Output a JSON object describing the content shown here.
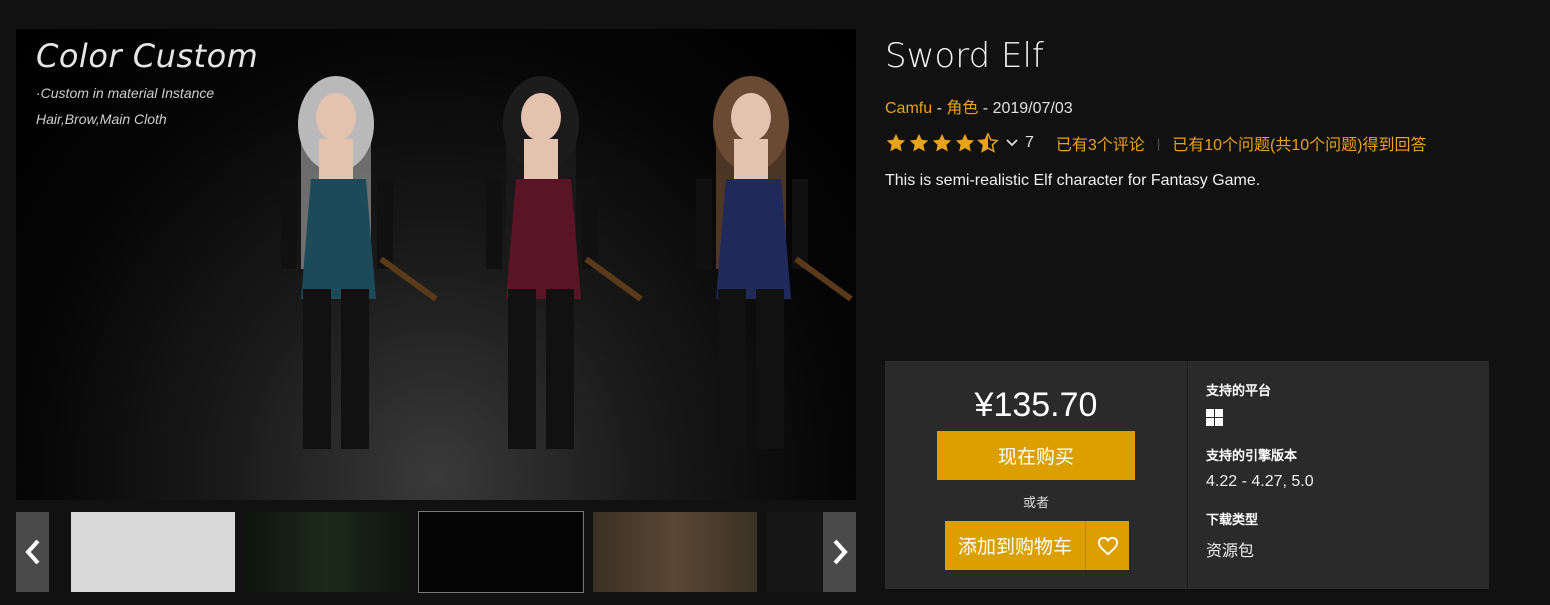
{
  "hero": {
    "overlay_title": "Color Custom",
    "overlay_line1": "·Custom in material Instance",
    "overlay_line2": "Hair,Brow,Main Cloth"
  },
  "gallery": {
    "prev_icon": "chevron-left-icon",
    "next_icon": "chevron-right-icon",
    "thumbnail_count": 5
  },
  "product": {
    "title": "Sword Elf",
    "seller": "Camfu",
    "meta_sep1": " - ",
    "category": "角色",
    "meta_sep2": " - ",
    "date": "2019/07/03",
    "rating_value": 4.5,
    "rating_count": "7",
    "reviews_link": "已有3个评论",
    "questions_link": "已有10个问题(共10个问题)得到回答",
    "description": "This is semi-realistic Elf character for Fantasy Game."
  },
  "purchase": {
    "price": "¥135.70",
    "buy_now": "现在购买",
    "or": "或者",
    "add_to_cart": "添加到购物车",
    "wishlist_icon": "heart-icon"
  },
  "specs": {
    "platform_label": "支持的平台",
    "platform_icon": "windows-icon",
    "engine_label": "支持的引擎版本",
    "engine_value": "4.22 - 4.27, 5.0",
    "download_label": "下载类型",
    "download_value": "资源包"
  },
  "colors": {
    "accent": "#e8a317",
    "button": "#dba000",
    "background": "#111111",
    "panel": "#2a2a2a"
  }
}
